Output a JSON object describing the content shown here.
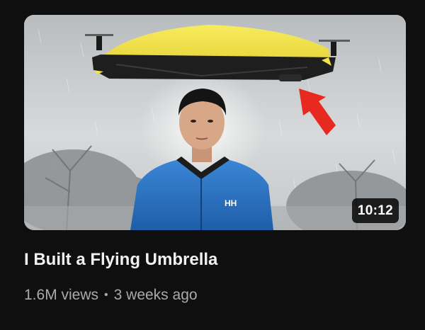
{
  "video": {
    "title": "I Built a Flying Umbrella",
    "views": "1.6M views",
    "separator": "•",
    "age": "3 weeks ago",
    "duration": "10:12",
    "logo_text": "HH"
  },
  "colors": {
    "background": "#0f0f0f",
    "title": "#f1f1f1",
    "meta": "#aaaaaa",
    "umbrella": "#f2e34a",
    "jacket": "#2a72c4",
    "arrow": "#e8291f"
  }
}
